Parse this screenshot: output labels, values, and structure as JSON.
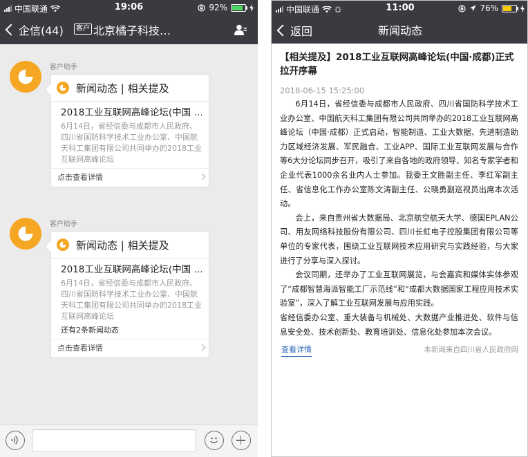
{
  "left_phone": {
    "status": {
      "carrier": "中国联通",
      "time": "19:06",
      "battery": "92%",
      "battery_level": 0.92
    },
    "nav": {
      "back_label": "企信(44)",
      "tag": "客户",
      "title": "北京橘子科技…"
    },
    "messages": [
      {
        "sender": "客户助手",
        "card_title": "新闻动态 | 相关提及",
        "news_title": "2018工业互联网高峰论坛(中国 …",
        "summary": "6月14日，省经信委与成都市人民政府、四川省国防科学技术工业办公室、中国航天科工集团有限公司共同举办的2018工业互联网高峰论坛",
        "more": "",
        "footer": "点击查看详情"
      },
      {
        "sender": "客户助手",
        "card_title": "新闻动态 | 相关提及",
        "news_title": "2018工业互联网高峰论坛(中国 …",
        "summary": "6月14日，省经信委与成都市人民政府、四川省国防科学技术工业办公室、中国航天科工集团有限公司共同举办的2018工业互联网高峰论坛",
        "more": "还有2条新闻动态",
        "footer": "点击查看详情"
      }
    ],
    "input": {
      "value": ""
    }
  },
  "right_phone": {
    "status": {
      "carrier": "中国联通",
      "time": "11:00",
      "battery": "76%",
      "battery_level": 0.76
    },
    "nav": {
      "back_label": "返回",
      "title": "新闻动态"
    },
    "article": {
      "title": "【相关提及】2018工业互联网高峰论坛(中国·成都)正式拉开序幕",
      "date": "2018-06-15 15:25:00",
      "paragraphs": [
        "6月14日，省经信委与成都市人民政府、四川省国防科学技术工业办公室、中国航天科工集团有限公司共同举办的2018工业互联网高峰论坛（中国·成都）正式启动，智能制造、工业大数据、先进制造助力区域经济发展、军民融合、工业APP、国际工业互联网发展与合作等6大分论坛同步召开，吸引了来自各地的政府领导、知名专家学者和企业代表1000余名业内人士参加。我委王文胜副主任、李红军副主任、省信息化工作办公室陈文涛副主任、公晓勇副巡视员出席本次活动。",
        "会上，来自贵州省大数据局、北京航空航天大学、德国EPLAN公司、用友网络科技股份有限公司、四川长虹电子控股集团有限公司等单位的专家代表，围绕工业互联网技术应用研究与实践经验，与大家进行了分享与深入探讨。",
        "会议同期，还举办了工业互联网展览，与会嘉宾和媒体实体参观了“成都智慧海派智能工厂示范线”和“成都大数据国家工程应用技术实验室”，深入了解工业互联网发展与应用实践。",
        "省经信委办公室、重大装备与机械处、大数据产业推进处、软件与信息安全处、技术创新处、教育培训处、信息化处参加本次会议。"
      ],
      "view_more": "查看详情",
      "source": "本新闻来自四川省人民政府网"
    }
  },
  "colors": {
    "nav_bg": "#3b3a40",
    "accent": "#f5a623",
    "battery_green": "#4cd964",
    "battery_yellow": "#ffcc00",
    "link": "#2a6ab5"
  }
}
